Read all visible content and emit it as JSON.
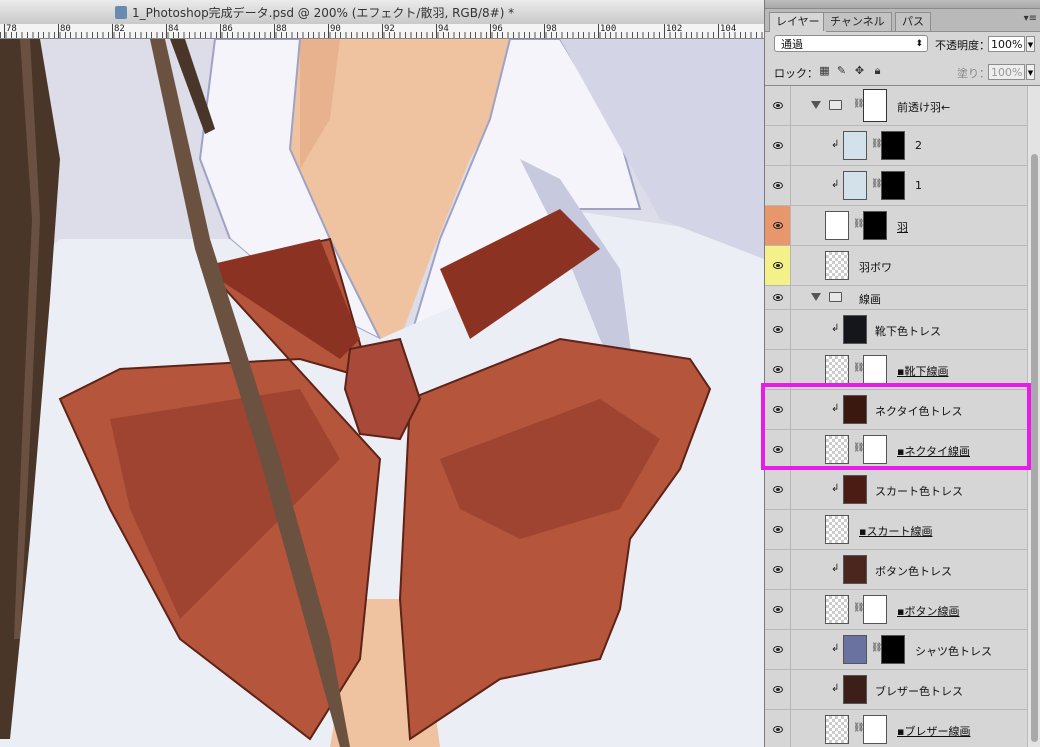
{
  "document": {
    "title": "1_Photoshop完成データ.psd @ 200% (エフェクト/散羽, RGB/8#) *",
    "ruler_labels": [
      "78",
      "80",
      "82",
      "84",
      "86",
      "88",
      "90",
      "92",
      "94",
      "96",
      "98",
      "100",
      "102",
      "104"
    ]
  },
  "panel": {
    "tabs": [
      "レイヤー",
      "チャンネル",
      "パス"
    ],
    "active_tab": "レイヤー",
    "blend_mode": "通過",
    "opacity_label": "不透明度：",
    "opacity_value": "100%",
    "lock_label": "ロック：",
    "fill_label": "塗り：",
    "fill_value": "100%"
  },
  "layers": [
    {
      "name": "前透け羽←",
      "kind": "group",
      "thumb": "mask"
    },
    {
      "name": "2",
      "kind": "clip",
      "thumb": "lightblue",
      "mask": "black-sparks"
    },
    {
      "name": "1",
      "kind": "clip",
      "thumb": "lightblue",
      "mask": "black-wings"
    },
    {
      "name": "羽",
      "kind": "layer",
      "thumb": "white",
      "mask": "black-wings",
      "label_color": "orange",
      "underline": true
    },
    {
      "name": "羽ボワ",
      "kind": "layer",
      "thumb": "check",
      "label_color": "yellow"
    },
    {
      "name": "線画",
      "kind": "group-header"
    },
    {
      "name": "靴下色トレス",
      "kind": "clip",
      "thumb_color": "#15151c"
    },
    {
      "name": "▪靴下線画",
      "kind": "layer",
      "thumb": "check",
      "mask": "white",
      "underline": true
    },
    {
      "name": "ネクタイ色トレス",
      "kind": "clip",
      "thumb_color": "#3a1810"
    },
    {
      "name": "▪ネクタイ線画",
      "kind": "layer",
      "thumb": "check",
      "mask": "white",
      "underline": true
    },
    {
      "name": "スカート色トレス",
      "kind": "clip",
      "thumb_color": "#4a1c14"
    },
    {
      "name": "▪スカート線画",
      "kind": "layer",
      "thumb": "check",
      "underline": true
    },
    {
      "name": "ボタン色トレス",
      "kind": "clip",
      "thumb_color": "#4a261e"
    },
    {
      "name": "▪ボタン線画",
      "kind": "layer",
      "thumb": "check",
      "mask": "white",
      "underline": true
    },
    {
      "name": "シャツ色トレス",
      "kind": "clip",
      "thumb_color": "#6a72a0",
      "mask": "black"
    },
    {
      "name": "ブレザー色トレス",
      "kind": "clip",
      "thumb_color": "#3e1e18"
    },
    {
      "name": "▪ブレザー線画",
      "kind": "layer",
      "thumb": "check",
      "mask": "white",
      "underline": true
    }
  ],
  "colors": {
    "highlight": "#e81ce8",
    "tie": "#b0513a",
    "tie_dark": "#7b2a1e",
    "shirt": "#f2f2f8",
    "shirt_shadow": "#c9cbe0",
    "skin": "#f2c4a0",
    "hair": "#4a3628"
  }
}
